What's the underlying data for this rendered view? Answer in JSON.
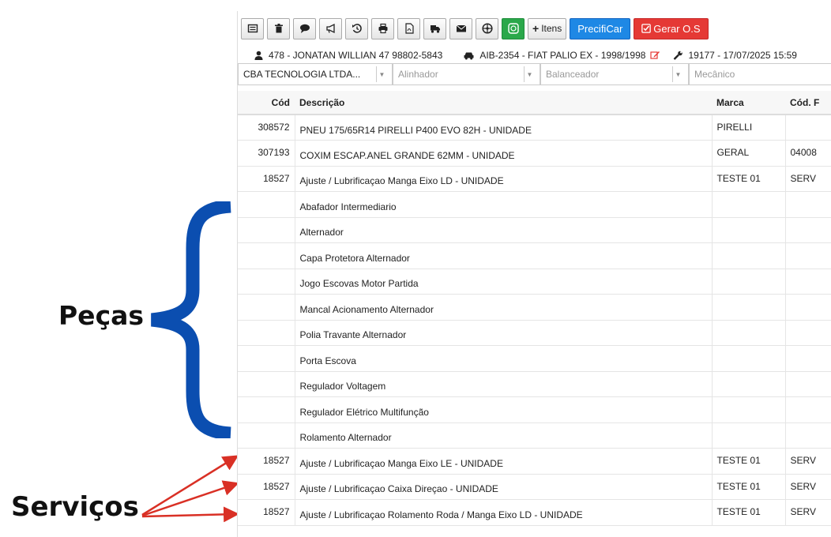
{
  "annotations": {
    "pecas_label": "Peças",
    "servicos_label": "Serviços",
    "brace_color": "#0b4eb0",
    "arrow_color": "#d93025"
  },
  "toolbar": {
    "buttons": [
      {
        "icon": "list-icon"
      },
      {
        "icon": "trash-icon"
      },
      {
        "icon": "comment-icon"
      },
      {
        "icon": "megaphone-icon"
      },
      {
        "icon": "history-icon"
      },
      {
        "icon": "print-icon"
      },
      {
        "icon": "pdf-icon"
      },
      {
        "icon": "truck-icon"
      },
      {
        "icon": "envelope-icon"
      },
      {
        "icon": "wheel-icon"
      },
      {
        "icon": "whatsapp-icon"
      }
    ],
    "itens_label": "Itens",
    "precificar_label": "PrecifiCar",
    "gerar_os_label": "Gerar O.S",
    "colors": {
      "green": "#2aa84a",
      "blue": "#1e88e5",
      "red": "#e53935"
    }
  },
  "info": {
    "customer": "478 - JONATAN WILLIAN 47 98802-5843",
    "vehicle": "AIB-2354 - FIAT PALIO EX - 1998/1998",
    "order": "19177 - 17/07/2025 15:59"
  },
  "selects": {
    "company": "CBA TECNOLOGIA LTDA...",
    "alinhador_placeholder": "Alinhador",
    "balanceador_placeholder": "Balanceador",
    "mecanico_placeholder": "Mecânico"
  },
  "table": {
    "headers": {
      "cod": "Cód",
      "descricao": "Descrição",
      "marca": "Marca",
      "cod_f": "Cód. F"
    },
    "rows": [
      {
        "cod": "308572",
        "desc": "PNEU 175/65R14 PIRELLI P400 EVO 82H - UNIDADE",
        "marca": "PIRELLI",
        "codf": ""
      },
      {
        "cod": "307193",
        "desc": "COXIM ESCAP.ANEL GRANDE 62MM - UNIDADE",
        "marca": "GERAL",
        "codf": "04008"
      },
      {
        "cod": "18527",
        "desc": "Ajuste / Lubrificaçao Manga Eixo LD - UNIDADE",
        "marca": "TESTE 01",
        "codf": "SERV"
      },
      {
        "cod": "",
        "desc": "Abafador Intermediario",
        "marca": "",
        "codf": ""
      },
      {
        "cod": "",
        "desc": "Alternador",
        "marca": "",
        "codf": ""
      },
      {
        "cod": "",
        "desc": "Capa Protetora Alternador",
        "marca": "",
        "codf": ""
      },
      {
        "cod": "",
        "desc": "Jogo Escovas Motor Partida",
        "marca": "",
        "codf": ""
      },
      {
        "cod": "",
        "desc": "Mancal Acionamento Alternador",
        "marca": "",
        "codf": ""
      },
      {
        "cod": "",
        "desc": "Polia Travante Alternador",
        "marca": "",
        "codf": ""
      },
      {
        "cod": "",
        "desc": "Porta Escova",
        "marca": "",
        "codf": ""
      },
      {
        "cod": "",
        "desc": "Regulador Voltagem",
        "marca": "",
        "codf": ""
      },
      {
        "cod": "",
        "desc": "Regulador Elétrico Multifunção",
        "marca": "",
        "codf": ""
      },
      {
        "cod": "",
        "desc": "Rolamento Alternador",
        "marca": "",
        "codf": ""
      },
      {
        "cod": "18527",
        "desc": "Ajuste / Lubrificaçao Manga Eixo LE - UNIDADE",
        "marca": "TESTE 01",
        "codf": "SERV"
      },
      {
        "cod": "18527",
        "desc": "Ajuste / Lubrificaçao Caixa Direçao - UNIDADE",
        "marca": "TESTE 01",
        "codf": "SERV"
      },
      {
        "cod": "18527",
        "desc": "Ajuste / Lubrificaçao Rolamento Roda / Manga Eixo LD - UNIDADE",
        "marca": "TESTE 01",
        "codf": "SERV"
      }
    ]
  }
}
